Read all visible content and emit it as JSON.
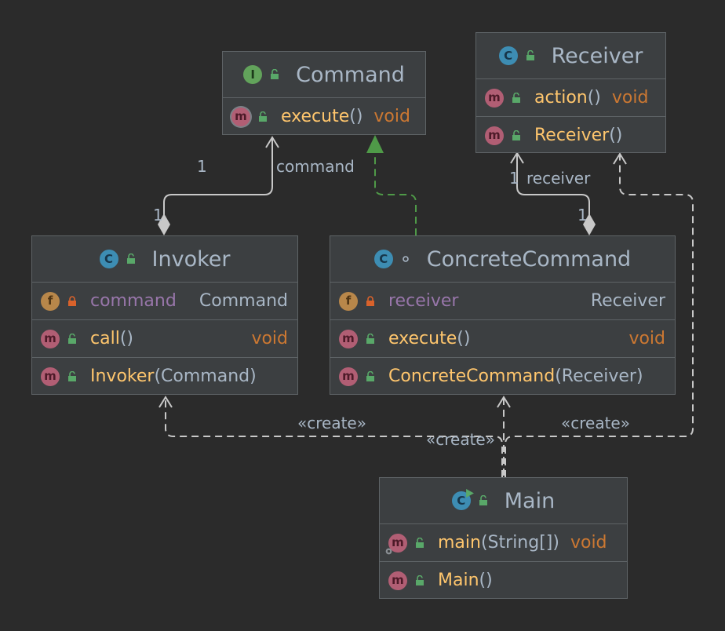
{
  "colors": {
    "background": "#2b2b2b",
    "box": "#3c3f41",
    "border": "#5e6366",
    "method_name": "#ffc66d",
    "field_name": "#9876aa",
    "keyword": "#cc7832",
    "text": "#a9b7c6",
    "lock_private": "#d9622b",
    "public_unlock": "#59a869",
    "realization_arrow": "#4f9a48",
    "connector": "#c8c8c8"
  },
  "classes": {
    "command": {
      "kind_badge": "I",
      "name": "Command",
      "members": [
        {
          "badge": "m",
          "name": "execute",
          "params": "()",
          "type": "void"
        }
      ]
    },
    "receiver": {
      "kind_badge": "C",
      "name": "Receiver",
      "members": [
        {
          "badge": "m",
          "name": "action",
          "params": "()",
          "type": "void"
        },
        {
          "badge": "m",
          "name": "Receiver",
          "params": "()",
          "type": ""
        }
      ]
    },
    "invoker": {
      "kind_badge": "C",
      "name": "Invoker",
      "field": {
        "badge": "f",
        "name": "command",
        "type": "Command"
      },
      "members": [
        {
          "badge": "m",
          "name": "call",
          "params": "()",
          "type": "void"
        },
        {
          "badge": "m",
          "name": "Invoker",
          "params": "(Command)",
          "type": ""
        }
      ]
    },
    "concrete_command": {
      "kind_badge": "C",
      "name": "ConcreteCommand",
      "field": {
        "badge": "f",
        "name": "receiver",
        "type": "Receiver"
      },
      "members": [
        {
          "badge": "m",
          "name": "execute",
          "params": "()",
          "type": "void"
        },
        {
          "badge": "m",
          "name": "ConcreteCommand",
          "params": "(Receiver)",
          "type": ""
        }
      ]
    },
    "main": {
      "kind_badge": "C",
      "name": "Main",
      "members": [
        {
          "badge": "m",
          "name": "main",
          "params": "(String[])",
          "type": "void"
        },
        {
          "badge": "m",
          "name": "Main",
          "params": "()",
          "type": ""
        }
      ]
    }
  },
  "relations": {
    "invoker_command": {
      "role": "command",
      "source_mult": "1",
      "target_mult": "1"
    },
    "concrete_receiver": {
      "role": "receiver",
      "source_mult": "1",
      "target_mult": "1"
    },
    "create_labels": [
      "«create»",
      "«create»",
      "«create»"
    ]
  }
}
